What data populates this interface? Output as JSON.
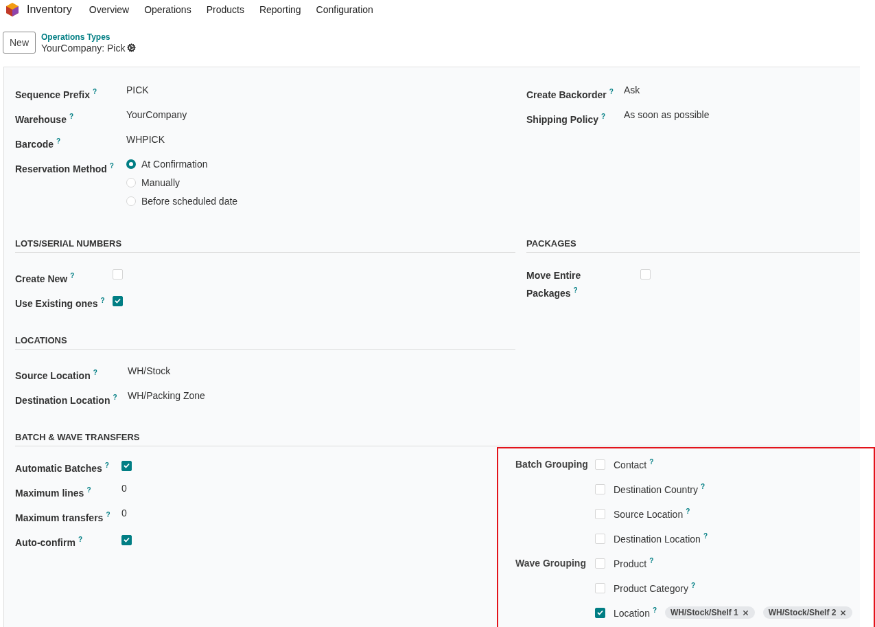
{
  "navbar": {
    "app": "Inventory",
    "menu": [
      "Overview",
      "Operations",
      "Products",
      "Reporting",
      "Configuration"
    ]
  },
  "control_panel": {
    "new_button": "New",
    "breadcrumb": "Operations Types",
    "record": "YourCompany: Pick"
  },
  "general": {
    "left": [
      {
        "kind": "text",
        "label": "Sequence Prefix",
        "help": "?",
        "value": "PICK"
      },
      {
        "kind": "text",
        "label": "Warehouse",
        "help": "?",
        "value": "YourCompany"
      },
      {
        "kind": "text",
        "label": "Barcode",
        "help": "?",
        "value": "WHPICK"
      },
      {
        "kind": "radio",
        "label": "Reservation Method",
        "help": "?",
        "options": [
          {
            "label": "At Confirmation",
            "selected": true
          },
          {
            "label": "Manually",
            "selected": false
          },
          {
            "label": "Before scheduled date",
            "selected": false
          }
        ]
      }
    ],
    "right": [
      {
        "kind": "text",
        "label": "Create Backorder",
        "help": "?",
        "value": "Ask"
      },
      {
        "kind": "text",
        "label": "Shipping Policy",
        "help": "?",
        "value": "As soon as possible"
      }
    ]
  },
  "lots": {
    "title": "LOTS/SERIAL NUMBERS",
    "fields": [
      {
        "kind": "checkbox",
        "label": "Create New",
        "help": "?",
        "checked": false
      },
      {
        "kind": "checkbox",
        "label": "Use Existing ones",
        "help": "?",
        "checked": true
      }
    ]
  },
  "packages": {
    "title": "PACKAGES",
    "fields": [
      {
        "kind": "checkbox",
        "label": "Move Entire Packages",
        "help": "?",
        "checked": false
      }
    ]
  },
  "locations": {
    "title": "LOCATIONS",
    "fields": [
      {
        "kind": "text",
        "label": "Source Location",
        "help": "?",
        "value": "WH/Stock"
      },
      {
        "kind": "text",
        "label": "Destination Location",
        "help": "?",
        "value": "WH/Packing Zone"
      }
    ]
  },
  "batch": {
    "title": "BATCH & WAVE TRANSFERS",
    "fields": [
      {
        "kind": "checkbox",
        "label": "Automatic Batches",
        "help": "?",
        "checked": true
      },
      {
        "kind": "text",
        "label": "Maximum lines",
        "help": "?",
        "value": "0"
      },
      {
        "kind": "text",
        "label": "Maximum transfers",
        "help": "?",
        "value": "0"
      },
      {
        "kind": "checkbox",
        "label": "Auto-confirm",
        "help": "?",
        "checked": true
      }
    ],
    "groupings": [
      {
        "label": "Batch Grouping",
        "options": [
          {
            "label": "Contact",
            "help": "?",
            "checked": false
          },
          {
            "label": "Destination Country",
            "help": "?",
            "checked": false
          },
          {
            "label": "Source Location",
            "help": "?",
            "checked": false
          },
          {
            "label": "Destination Location",
            "help": "?",
            "checked": false
          }
        ]
      },
      {
        "label": "Wave Grouping",
        "options": [
          {
            "label": "Product",
            "help": "?",
            "checked": false
          },
          {
            "label": "Product Category",
            "help": "?",
            "checked": false
          },
          {
            "label": "Location",
            "help": "?",
            "checked": true,
            "tags": [
              "WH/Stock/Shelf 1",
              "WH/Stock/Shelf 2"
            ]
          }
        ]
      }
    ]
  }
}
